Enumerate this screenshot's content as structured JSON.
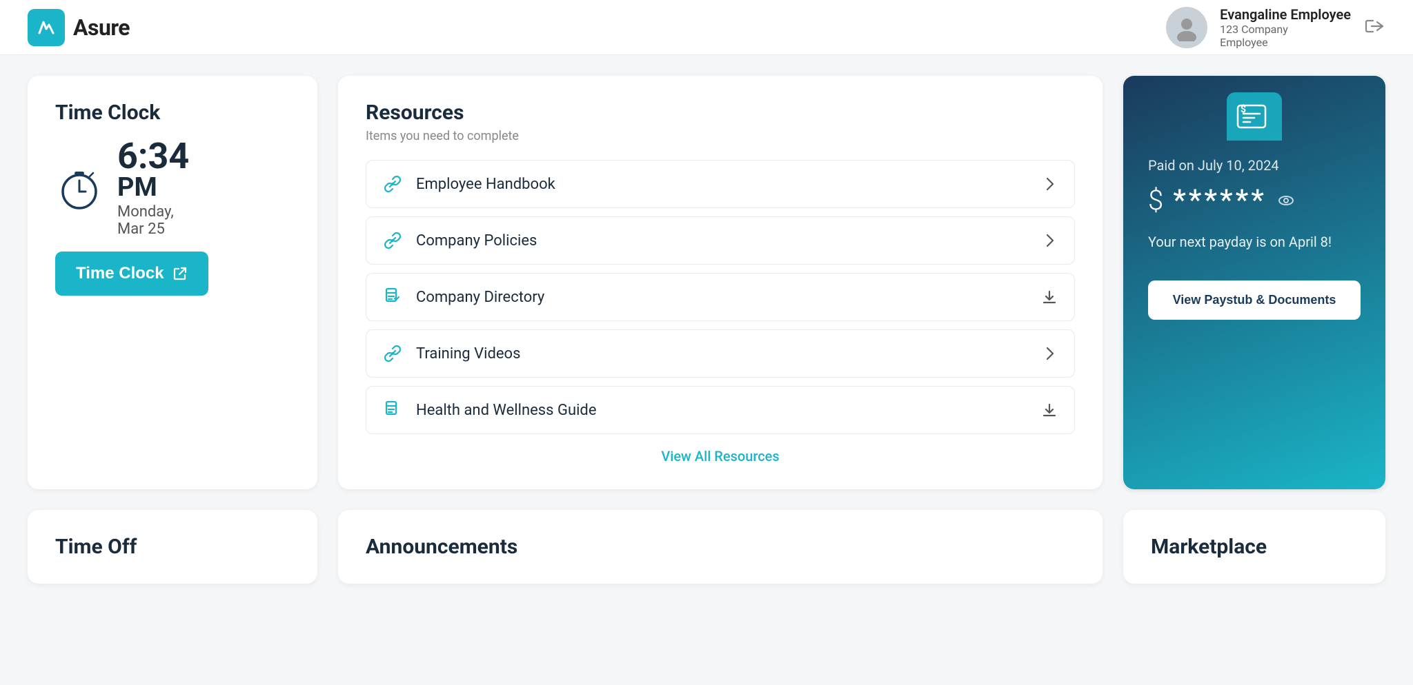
{
  "header": {
    "logo_text": "Asure",
    "user": {
      "name": "Evangaline Employee",
      "company": "123 Company",
      "role": "Employee"
    }
  },
  "time_clock": {
    "title": "Time Clock",
    "time": "6:34",
    "period": "PM",
    "date": "Monday,",
    "date2": "Mar 25",
    "button_label": "Time Clock"
  },
  "resources": {
    "title": "Resources",
    "subtitle": "Items you need to complete",
    "items": [
      {
        "label": "Employee Handbook",
        "icon": "link",
        "action": "chevron"
      },
      {
        "label": "Company Policies",
        "icon": "link",
        "action": "chevron"
      },
      {
        "label": "Company Directory",
        "icon": "document",
        "action": "download"
      },
      {
        "label": "Training Videos",
        "icon": "link",
        "action": "chevron"
      },
      {
        "label": "Health and Wellness Guide",
        "icon": "document",
        "action": "download"
      }
    ],
    "view_all": "View All Resources"
  },
  "paystub": {
    "paid_on": "Paid on July 10, 2024",
    "amount_masked": "******",
    "next_payday": "Your next payday is on April 8!",
    "button_label": "View Paystub & Documents"
  },
  "bottom": {
    "time_off_title": "Time Off",
    "announcements_title": "Announcements",
    "marketplace_title": "Marketplace"
  }
}
